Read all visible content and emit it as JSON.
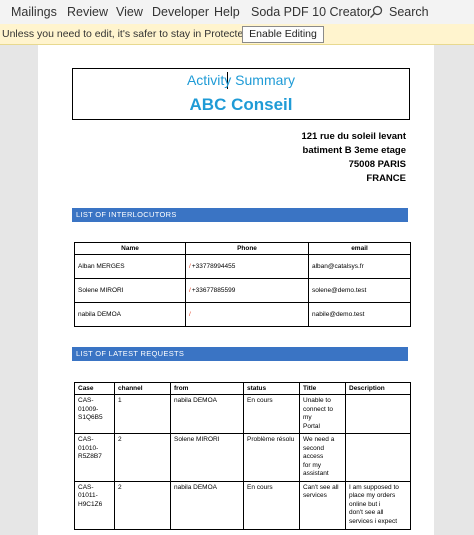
{
  "ribbon": {
    "menus": [
      "Mailings",
      "Review",
      "View",
      "Developer",
      "Help",
      "Soda PDF 10 Creator"
    ],
    "search_label": "Search",
    "search_icon": "search-icon"
  },
  "protected_view": {
    "message": "Unless you need to edit, it's safer to stay in Protected View.",
    "button_label": "Enable Editing"
  },
  "document": {
    "title": "Activity Summary",
    "company": "ABC Conseil",
    "address": [
      "121 rue du soleil levant",
      "batiment B 3eme etage",
      "75008 PARIS",
      "FRANCE"
    ],
    "interlocutors": {
      "section_title": "LIST OF INTERLOCUTORS",
      "headers": [
        "Name",
        "Phone",
        "email"
      ],
      "rows": [
        [
          "Alban MERGES",
          "+33778994455",
          "alban@catalsys.fr"
        ],
        [
          "Solene MIRORI",
          "+33677885599",
          "solene@demo.test"
        ],
        [
          "nabila DEMOA",
          "",
          "nabile@demo.test"
        ]
      ]
    },
    "requests": {
      "section_title": "LIST OF LATEST REQUESTS",
      "headers": [
        "Case",
        "channel",
        "from",
        "status",
        "Title",
        "Description"
      ],
      "rows": [
        [
          "CAS-01009-\nS1Q6B5",
          "1",
          "nabila DEMOA",
          "En cours",
          "Unable to\nconnect to my\nPortal",
          ""
        ],
        [
          "CAS-01010-\nR5Z8B7",
          "2",
          "Solene MIRORI",
          "Problème résolu",
          "We need a\nsecond access\nfor my\nassistant",
          ""
        ],
        [
          "CAS-01011-\nH9C1Z6",
          "2",
          "nabila DEMOA",
          "En cours",
          "Can't see all\nservices",
          "I am supposed to\nplace my orders\nonline but i\ndon't see all\nservices i expect"
        ]
      ]
    }
  },
  "colors": {
    "accent": "#1f9bd6",
    "section_bar": "#3a74c4",
    "protected_bar": "#fff4ce"
  }
}
